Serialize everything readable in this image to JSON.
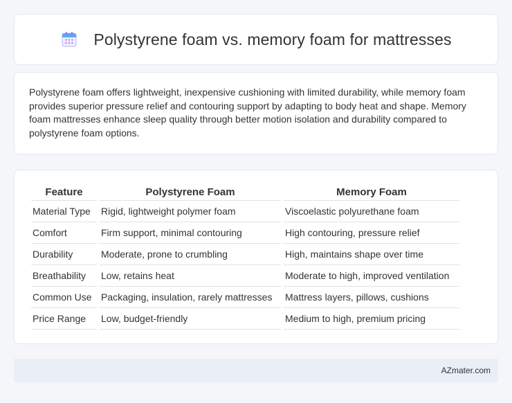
{
  "header": {
    "icon": "calendar-icon",
    "title": "Polystyrene foam vs. memory foam for mattresses"
  },
  "summary": {
    "text": "Polystyrene foam offers lightweight, inexpensive cushioning with limited durability, while memory foam provides superior pressure relief and contouring support by adapting to body heat and shape. Memory foam mattresses enhance sleep quality through better motion isolation and durability compared to polystyrene foam options."
  },
  "table": {
    "headers": [
      "Feature",
      "Polystyrene Foam",
      "Memory Foam"
    ],
    "rows": [
      [
        "Material Type",
        "Rigid, lightweight polymer foam",
        "Viscoelastic polyurethane foam"
      ],
      [
        "Comfort",
        "Firm support, minimal contouring",
        "High contouring, pressure relief"
      ],
      [
        "Durability",
        "Moderate, prone to crumbling",
        "High, maintains shape over time"
      ],
      [
        "Breathability",
        "Low, retains heat",
        "Moderate to high, improved ventilation"
      ],
      [
        "Common Use",
        "Packaging, insulation, rarely mattresses",
        "Mattress layers, pillows, cushions"
      ],
      [
        "Price Range",
        "Low, budget-friendly",
        "Medium to high, premium pricing"
      ]
    ]
  },
  "footer": {
    "site": "AZmater.com"
  },
  "colors": {
    "background": "#f4f6fa",
    "card": "#ffffff",
    "footer": "#e9eef7",
    "icon_accent": "#8b7be8"
  }
}
